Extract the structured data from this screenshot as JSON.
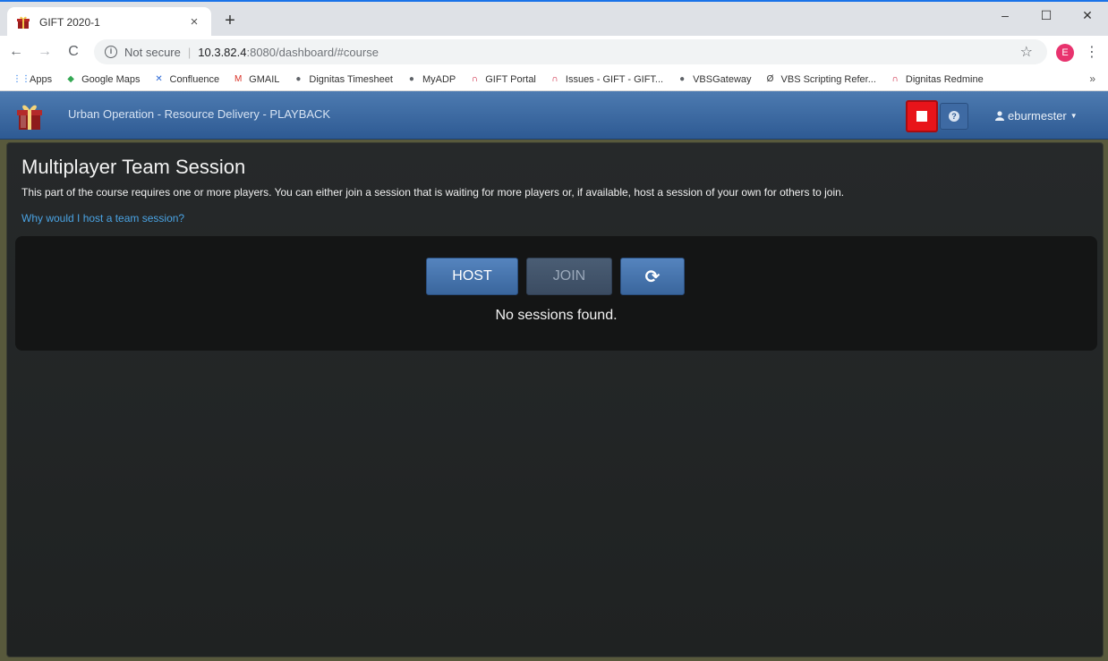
{
  "browser": {
    "tab_title": "GIFT 2020-1",
    "tab_close": "×",
    "new_tab": "+",
    "window_controls": {
      "minimize": "–",
      "maximize": "☐",
      "close": "✕"
    },
    "nav": {
      "back": "←",
      "forward": "→",
      "reload": "C"
    },
    "omnibox": {
      "security_label": "Not secure",
      "separator": "|",
      "url_host": "10.3.82.4",
      "url_rest": ":8080/dashboard/#course"
    },
    "star": "☆",
    "profile_initial": "E",
    "menu": "⋮",
    "bookmarks": [
      {
        "label": "Apps",
        "icon": "apps-grid-icon",
        "color": "#1a73e8"
      },
      {
        "label": "Google Maps",
        "icon": "maps-icon",
        "color": "#34a853"
      },
      {
        "label": "Confluence",
        "icon": "confluence-icon",
        "color": "#2f6bd6"
      },
      {
        "label": "GMAIL",
        "icon": "gmail-icon",
        "color": "#d93025"
      },
      {
        "label": "Dignitas Timesheet",
        "icon": "globe-icon",
        "color": "#5f6368"
      },
      {
        "label": "MyADP",
        "icon": "globe-icon",
        "color": "#5f6368"
      },
      {
        "label": "GIFT Portal",
        "icon": "redmine-icon",
        "color": "#c8102e"
      },
      {
        "label": "Issues - GIFT - GIFT...",
        "icon": "redmine-icon",
        "color": "#c8102e"
      },
      {
        "label": "VBSGateway",
        "icon": "globe-icon",
        "color": "#5f6368"
      },
      {
        "label": "VBS Scripting Refer...",
        "icon": "vbs-icon",
        "color": "#333333"
      },
      {
        "label": "Dignitas Redmine",
        "icon": "redmine-icon",
        "color": "#c8102e"
      }
    ],
    "bookmarks_more": "»"
  },
  "header": {
    "course_title": "Urban Operation - Resource Delivery - PLAYBACK",
    "help_label": "?",
    "username": "eburmester",
    "caret": "▼"
  },
  "session": {
    "title": "Multiplayer Team Session",
    "description": "This part of the course requires one or more players. You can either join a session that is waiting for more players or, if available, host a session of your own for others to join.",
    "why_link": "Why would I host a team session?",
    "host_label": "HOST",
    "join_label": "JOIN",
    "refresh_icon": "⟳",
    "empty_message": "No sessions found."
  },
  "colors": {
    "header_blue": "#3a669d",
    "stop_red": "#e8141a",
    "link_blue": "#4aa3e3",
    "panel_bg": "#26292a",
    "page_olive": "#58593c"
  }
}
